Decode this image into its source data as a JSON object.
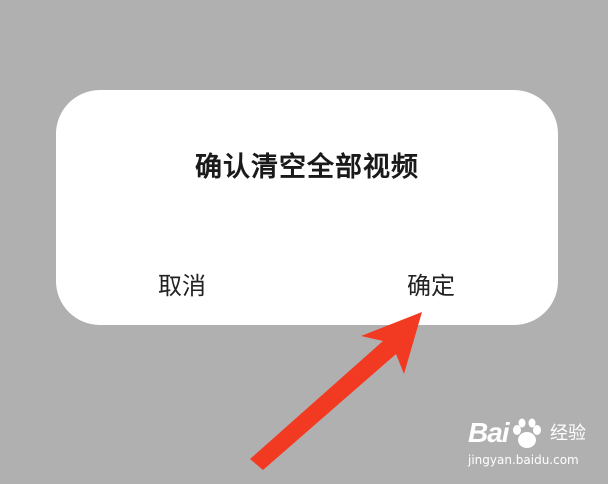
{
  "dialog": {
    "title": "确认清空全部视频",
    "cancel_label": "取消",
    "confirm_label": "确定"
  },
  "annotation": {
    "arrow_color": "#f23a22"
  },
  "watermark": {
    "logo_text": "Bai",
    "brand_text": "经验",
    "url_text": "jingyan.baidu.com"
  },
  "colors": {
    "overlay": "#b0b0b0",
    "dialog_bg": "#ffffff",
    "text": "#1a1a1a"
  }
}
